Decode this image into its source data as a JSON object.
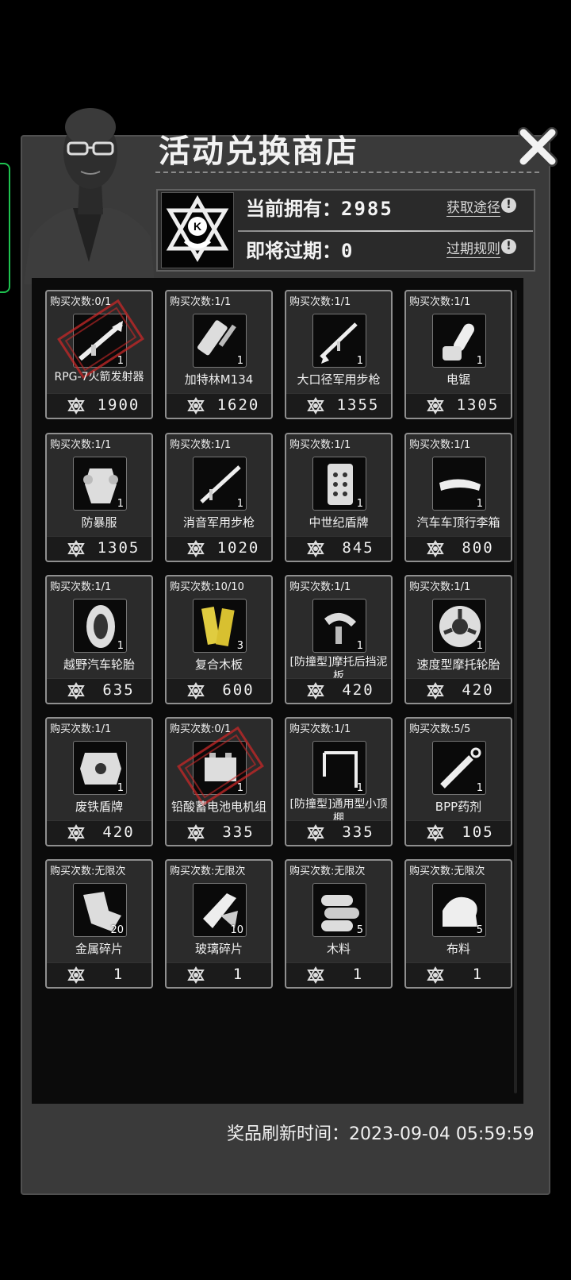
{
  "shop": {
    "title": "活动兑换商店",
    "owned_label": "当前拥有：",
    "owned_value": "2985",
    "expiring_label": "即将过期：",
    "expiring_value": "0",
    "obtain_link": "获取途径",
    "expiry_rules_link": "过期规则",
    "refresh_label": "奖品刷新时间：",
    "refresh_time": "2023-09-04 05:59:59"
  },
  "colors": {
    "stamp": "#c82828",
    "border": "#8f8f8f",
    "panel": "#3a3a3a"
  },
  "items": [
    {
      "limit": "购买次数:0/1",
      "name": "RPG-7火箭发射器",
      "qty": "1",
      "price": "1900",
      "icon": "rpg-icon",
      "sold_out": true
    },
    {
      "limit": "购买次数:1/1",
      "name": "加特林M134",
      "qty": "1",
      "price": "1620",
      "icon": "gatling-icon"
    },
    {
      "limit": "购买次数:1/1",
      "name": "大口径军用步枪",
      "qty": "1",
      "price": "1355",
      "icon": "rifle-icon"
    },
    {
      "limit": "购买次数:1/1",
      "name": "电锯",
      "qty": "1",
      "price": "1305",
      "icon": "chainsaw-icon"
    },
    {
      "limit": "购买次数:1/1",
      "name": "防暴服",
      "qty": "1",
      "price": "1305",
      "icon": "riot-suit-icon"
    },
    {
      "limit": "购买次数:1/1",
      "name": "消音军用步枪",
      "qty": "1",
      "price": "1020",
      "icon": "silenced-rifle-icon"
    },
    {
      "limit": "购买次数:1/1",
      "name": "中世纪盾牌",
      "qty": "1",
      "price": "845",
      "icon": "medieval-shield-icon"
    },
    {
      "limit": "购买次数:1/1",
      "name": "汽车车顶行李箱",
      "qty": "1",
      "price": "800",
      "icon": "roof-box-icon"
    },
    {
      "limit": "购买次数:1/1",
      "name": "越野汽车轮胎",
      "qty": "1",
      "price": "635",
      "icon": "tire-icon"
    },
    {
      "limit": "购买次数:10/10",
      "name": "复合木板",
      "qty": "3",
      "price": "600",
      "icon": "plywood-icon"
    },
    {
      "limit": "购买次数:1/1",
      "name": "[防撞型]摩托后挡泥板",
      "qty": "1",
      "price": "420",
      "icon": "mudguard-icon"
    },
    {
      "limit": "购买次数:1/1",
      "name": "速度型摩托轮胎",
      "qty": "1",
      "price": "420",
      "icon": "moto-tire-icon"
    },
    {
      "limit": "购买次数:1/1",
      "name": "废铁盾牌",
      "qty": "1",
      "price": "420",
      "icon": "scrap-shield-icon"
    },
    {
      "limit": "购买次数:0/1",
      "name": "铅酸蓄电池电机组",
      "qty": "1",
      "price": "335",
      "icon": "battery-icon",
      "sold_out": true
    },
    {
      "limit": "购买次数:1/1",
      "name": "[防撞型]通用型小顶棚",
      "qty": "1",
      "price": "335",
      "icon": "canopy-icon"
    },
    {
      "limit": "购买次数:5/5",
      "name": "BPP药剂",
      "qty": "1",
      "price": "105",
      "icon": "syringe-icon"
    },
    {
      "limit": "购买次数:无限次",
      "name": "金属碎片",
      "qty": "20",
      "price": "1",
      "icon": "metal-scrap-icon"
    },
    {
      "limit": "购买次数:无限次",
      "name": "玻璃碎片",
      "qty": "10",
      "price": "1",
      "icon": "glass-shard-icon"
    },
    {
      "limit": "购买次数:无限次",
      "name": "木料",
      "qty": "5",
      "price": "1",
      "icon": "wood-logs-icon"
    },
    {
      "limit": "购买次数:无限次",
      "name": "布料",
      "qty": "5",
      "price": "1",
      "icon": "cloth-icon"
    }
  ]
}
